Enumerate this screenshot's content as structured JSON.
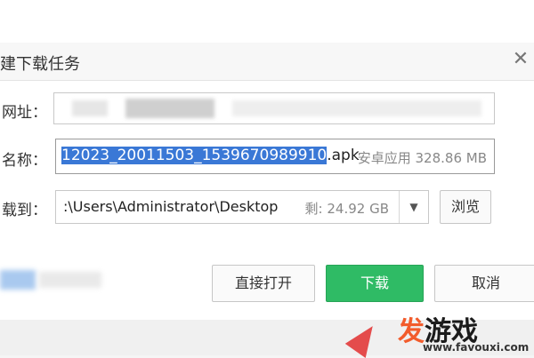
{
  "dialog": {
    "title": "建下载任务",
    "close_icon": "close-icon"
  },
  "form": {
    "url_label": "网址：",
    "url_value": "",
    "name_label": "名称：",
    "name_selected": "12023_20011503_1539670989910",
    "name_rest": ".apk",
    "name_meta": "安卓应用 328.86 MB",
    "path_label": "载到：",
    "path_value": ":\\Users\\Administrator\\Desktop",
    "path_free": "剩: 24.92 GB",
    "dropdown_icon": "chevron-down-icon",
    "browse_label": "浏览"
  },
  "actions": {
    "open_label": "直接打开",
    "download_label": "下载",
    "cancel_label": "取消"
  },
  "watermark": {
    "brand_fa": "发",
    "brand_rest": "游戏",
    "url": "www.favouxi.com"
  },
  "colors": {
    "accent_green": "#2fbb65",
    "selection_blue": "#3a78d6",
    "watermark_orange": "#f25c2c"
  }
}
